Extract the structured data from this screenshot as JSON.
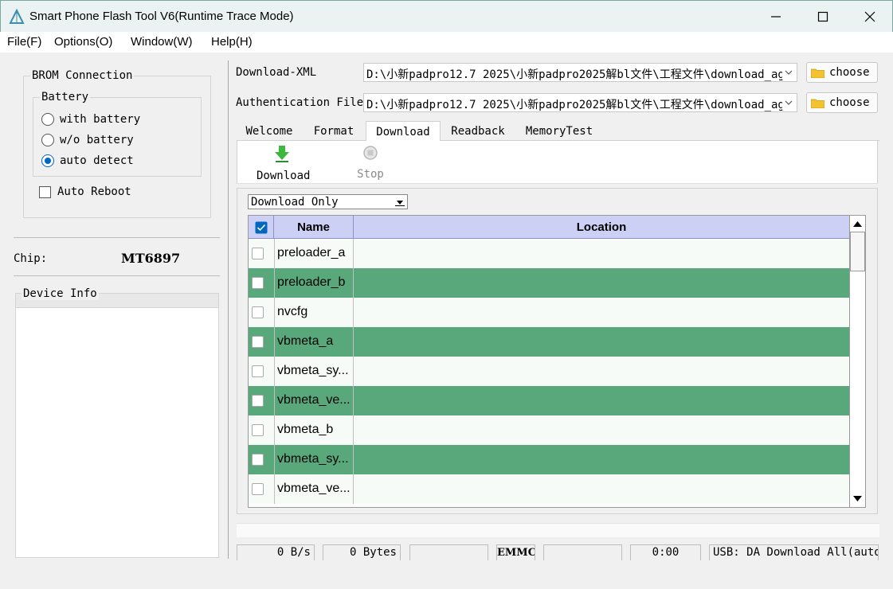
{
  "window": {
    "title": "Smart Phone Flash Tool V6(Runtime Trace Mode)",
    "icon": "tool-triangle-icon",
    "controls": [
      "minimize-icon",
      "maximize-icon",
      "close-icon"
    ]
  },
  "menu": [
    "File(F)",
    "Options(O)",
    "Window(W)",
    "Help(H)"
  ],
  "left": {
    "brom_label": "BROM Connection",
    "battery_label": "Battery",
    "battery_options": [
      {
        "label": "with battery",
        "selected": false
      },
      {
        "label": "w/o battery",
        "selected": false
      },
      {
        "label": "auto detect",
        "selected": true
      }
    ],
    "auto_reboot_label": "Auto Reboot",
    "auto_reboot_checked": false,
    "chip_label": "Chip:",
    "chip_value": "MT6897",
    "device_info_label": "Device Info"
  },
  "files": {
    "download_xml_label": "Download-XML",
    "download_xml_value": "D:\\小新padpro12.7 2025\\小新padpro2025解bl文件\\工程文件\\download_ag",
    "auth_label": "Authentication File",
    "auth_value": "D:\\小新padpro12.7 2025\\小新padpro2025解bl文件\\工程文件\\download_ag",
    "choose_label": "choose"
  },
  "tabs": [
    {
      "label": "Welcome",
      "active": false
    },
    {
      "label": "Format",
      "active": false
    },
    {
      "label": "Download",
      "active": true
    },
    {
      "label": "Readback",
      "active": false
    },
    {
      "label": "MemoryTest",
      "active": false
    }
  ],
  "toolbar": {
    "download_label": "Download",
    "stop_label": "Stop"
  },
  "mode_select": "Download Only",
  "table": {
    "columns": [
      "Name",
      "Location"
    ],
    "header_checked": true,
    "rows": [
      {
        "name": "preloader_a",
        "location": "",
        "checked": false
      },
      {
        "name": "preloader_b",
        "location": "",
        "checked": false
      },
      {
        "name": "nvcfg",
        "location": "",
        "checked": false
      },
      {
        "name": "vbmeta_a",
        "location": "",
        "checked": false
      },
      {
        "name": "vbmeta_sy...",
        "location": "",
        "checked": false
      },
      {
        "name": "vbmeta_ve...",
        "location": "",
        "checked": false
      },
      {
        "name": "vbmeta_b",
        "location": "",
        "checked": false
      },
      {
        "name": "vbmeta_sy...",
        "location": "",
        "checked": false
      },
      {
        "name": "vbmeta_ve...",
        "location": "",
        "checked": false
      }
    ]
  },
  "status": {
    "speed": "0 B/s",
    "bytes": "0 Bytes",
    "blank1": "",
    "storage": "EMMC",
    "blank2": "",
    "time": "0:00",
    "usb": "USB: DA Download All(auto"
  },
  "colors": {
    "accent": "#0067c0",
    "row_alt": "#58a87c",
    "header": "#cdd0f5"
  }
}
